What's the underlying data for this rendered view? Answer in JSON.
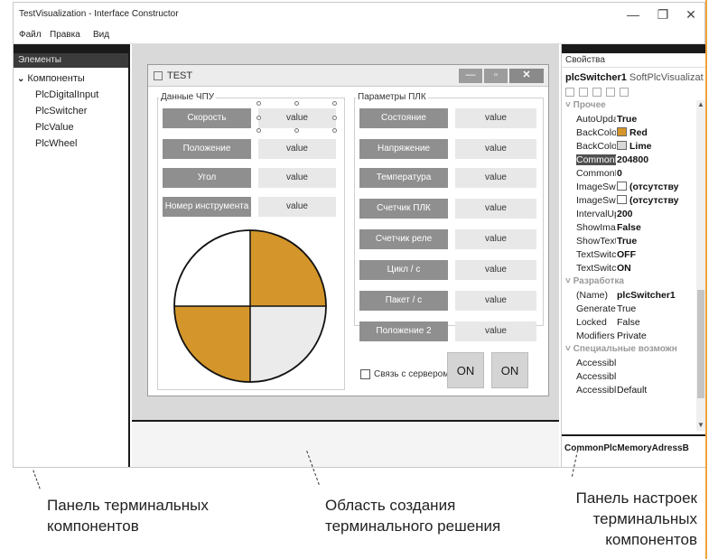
{
  "window": {
    "title": "TestVisualization - Interface Constructor",
    "minimize": "—",
    "restore": "❐",
    "close": "✕"
  },
  "menu": [
    "Файл",
    "Правка",
    "Вид"
  ],
  "left_panel": {
    "header": "Элементы",
    "group": "Компоненты",
    "items": [
      "PlcDigitalInput",
      "PlcSwitcher",
      "PlcValue",
      "PlcWheel"
    ]
  },
  "form": {
    "title": "TEST",
    "cnc_group": {
      "label": "Данные ЧПУ",
      "rows": [
        {
          "button": "Скорость",
          "value": "value"
        },
        {
          "button": "Положение",
          "value": "value"
        },
        {
          "button": "Угол",
          "value": "value"
        },
        {
          "button": "Номер инструмента",
          "value": "value"
        }
      ]
    },
    "plc_group": {
      "label": "Параметры ПЛК",
      "rows": [
        {
          "button": "Состояние",
          "value": "value"
        },
        {
          "button": "Напряжение",
          "value": "value"
        },
        {
          "button": "Температура",
          "value": "value"
        },
        {
          "button": "Счетчик ПЛК",
          "value": "value"
        },
        {
          "button": "Счетчик реле",
          "value": "value"
        },
        {
          "button": "Цикл / с",
          "value": "value"
        },
        {
          "button": "Пакет / с",
          "value": "value"
        },
        {
          "button": "Положение 2",
          "value": "value"
        }
      ]
    },
    "server_checkbox": "Связь с сервером",
    "on_buttons": [
      "ON",
      "ON"
    ],
    "wheel_colors": {
      "filled": "#d4962a",
      "empty": "#ffffff",
      "light": "#ebebeb"
    }
  },
  "right_panel": {
    "header": "Свойства",
    "object_name": "plcSwitcher1",
    "object_type": "SoftPlcVisualizat",
    "categories": {
      "misc": "Прочее",
      "design": "Разработка",
      "access": "Специальные возможн"
    },
    "properties_misc": [
      {
        "name": "AutoUpdat",
        "value": "True",
        "bold": true
      },
      {
        "name": "BackColorO",
        "value": "Red",
        "bold": true,
        "swatch": "#d4962a"
      },
      {
        "name": "BackColorS",
        "value": "Lime",
        "bold": true,
        "swatch": "#d8d8d8"
      },
      {
        "name": "CommonP",
        "value": "204800",
        "bold": true,
        "selected": true
      },
      {
        "name": "CommonP",
        "value": "0",
        "bold": true
      },
      {
        "name": "ImageSwitc",
        "value": "(отсутству",
        "bold": true,
        "swatch": "#ffffff"
      },
      {
        "name": "ImageSwitc",
        "value": "(отсутству",
        "bold": true,
        "swatch": "#ffffff"
      },
      {
        "name": "IntervalUpc",
        "value": "200",
        "bold": true
      },
      {
        "name": "ShowImag",
        "value": "False",
        "bold": true
      },
      {
        "name": "ShowText",
        "value": "True",
        "bold": true
      },
      {
        "name": "TextSwitch",
        "value": "OFF",
        "bold": true
      },
      {
        "name": "TextSwitch",
        "value": "ON",
        "bold": true
      }
    ],
    "properties_design": [
      {
        "name": "(Name)",
        "value": "plcSwitcher1",
        "bold": true
      },
      {
        "name": "GenerateM",
        "value": "True",
        "bold": false
      },
      {
        "name": "Locked",
        "value": "False",
        "bold": false
      },
      {
        "name": "Modifiers",
        "value": "Private",
        "bold": false
      }
    ],
    "properties_access": [
      {
        "name": "Accessiblel",
        "value": "",
        "bold": false
      },
      {
        "name": "Accessiblel",
        "value": "",
        "bold": false
      },
      {
        "name": "Accessiblel",
        "value": "Default",
        "bold": false
      }
    ],
    "description": "CommonPlcMemoryAdressB"
  },
  "captions": {
    "left": [
      "Панель терминальных",
      "компонентов"
    ],
    "middle": [
      "Область создания",
      "терминального решения"
    ],
    "right": [
      "Панель настроек",
      "терминальных",
      "компонентов"
    ]
  }
}
